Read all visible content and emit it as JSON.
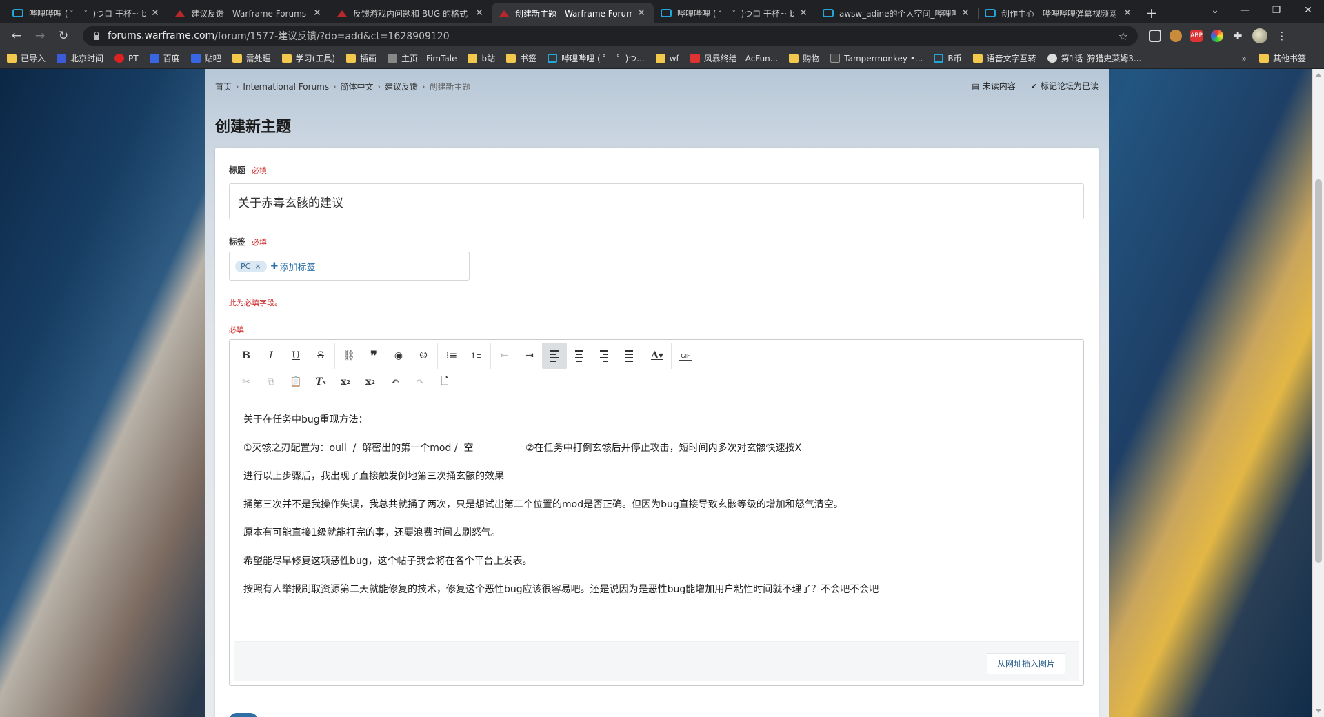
{
  "browser": {
    "tabs": [
      {
        "title": "哔哩哔哩 ( ゜- ゜)つロ 干杯~-bili",
        "favicon": "bilibili-icon",
        "active": false
      },
      {
        "title": "建议反馈 - Warframe Forums",
        "favicon": "warframe-icon",
        "active": false
      },
      {
        "title": "反馈游戏内问题和 BUG 的格式",
        "favicon": "warframe-icon",
        "active": false
      },
      {
        "title": "创建新主题 - Warframe Forum",
        "favicon": "warframe-icon",
        "active": true
      },
      {
        "title": "哔哩哔哩 ( ゜- ゜)つロ 干杯~-bili",
        "favicon": "bilibili-icon",
        "active": false
      },
      {
        "title": "awsw_adine的个人空间_哔哩哔",
        "favicon": "bilibili-icon",
        "active": false
      },
      {
        "title": "创作中心 - 哔哩哔哩弹幕视频网",
        "favicon": "bilibili-icon",
        "active": false
      }
    ],
    "url_host": "forums.warframe.com",
    "url_path": "/forum/1577-建议反馈/?do=add&ct=1628909120",
    "bookmarks": [
      {
        "label": "已导入",
        "icon": "folder-icon"
      },
      {
        "label": "北京时间",
        "icon": "clock-icon"
      },
      {
        "label": "PT",
        "icon": "apple-icon"
      },
      {
        "label": "百度",
        "icon": "baidu-icon"
      },
      {
        "label": "贴吧",
        "icon": "tieba-icon"
      },
      {
        "label": "需处理",
        "icon": "folder-icon"
      },
      {
        "label": "学习(工具)",
        "icon": "folder-icon"
      },
      {
        "label": "插画",
        "icon": "folder-icon"
      },
      {
        "label": "主页 - FimTale",
        "icon": "fimtale-icon"
      },
      {
        "label": "b站",
        "icon": "folder-icon"
      },
      {
        "label": "书签",
        "icon": "folder-icon"
      },
      {
        "label": "哔哩哔哩 ( ゜- ゜)つ...",
        "icon": "bilibili-icon"
      },
      {
        "label": "wf",
        "icon": "folder-icon"
      },
      {
        "label": "风暴终结 - AcFun...",
        "icon": "acfun-icon"
      },
      {
        "label": "购物",
        "icon": "folder-icon"
      },
      {
        "label": "Tampermonkey •...",
        "icon": "tampermonkey-icon"
      },
      {
        "label": "B币",
        "icon": "bilibili-icon"
      },
      {
        "label": "语音文字互转",
        "icon": "folder-icon"
      },
      {
        "label": "第1话_狩猎史莱姆3...",
        "icon": "globe-icon"
      }
    ],
    "more_bookmarks": "»",
    "other_bookmarks": "其他书签"
  },
  "breadcrumb": [
    "首页",
    "International Forums",
    "简体中文",
    "建议反馈"
  ],
  "breadcrumb_current": "创建新主题",
  "actions": {
    "unread": "未读内容",
    "mark_read": "标记论坛为已读"
  },
  "page_title": "创建新主题",
  "form": {
    "title_label": "标题",
    "required": "必填",
    "title_value": "关于赤毒玄骸的建议",
    "tags_label": "标签",
    "tag": "PC",
    "add_tag": "添加标签",
    "error": "此为必填字段。",
    "content_required": "必填",
    "insert_image": "从网址插入图片"
  },
  "editor_content": [
    "关于在任务中bug重现方法：",
    "①灭骸之刃配置为：oull  /  解密出的第一个mod /  空                 ②在任务中打倒玄骸后并停止攻击，短时间内多次对玄骸快速按X",
    "进行以上步骤后，我出现了直接触发倒地第三次捅玄骸的效果",
    "捅第三次并不是我操作失误，我总共就捅了两次，只是想试出第二个位置的mod是否正确。但因为bug直接导致玄骸等级的增加和怒气清空。",
    "原本有可能直接1级就能打完的事，还要浪费时间去刷怒气。",
    "希望能尽早修复这项恶性bug，这个帖子我会将在各个平台上发表。",
    "按照有人举报刷取资源第二天就能修复的技术，修复这个恶性bug应该很容易吧。还是说因为是恶性bug能增加用户粘性时间就不理了？不会吧不会吧"
  ],
  "colors": {
    "accent": "#2f6ea5",
    "required": "#cc2222",
    "link": "#2c6fa6"
  }
}
